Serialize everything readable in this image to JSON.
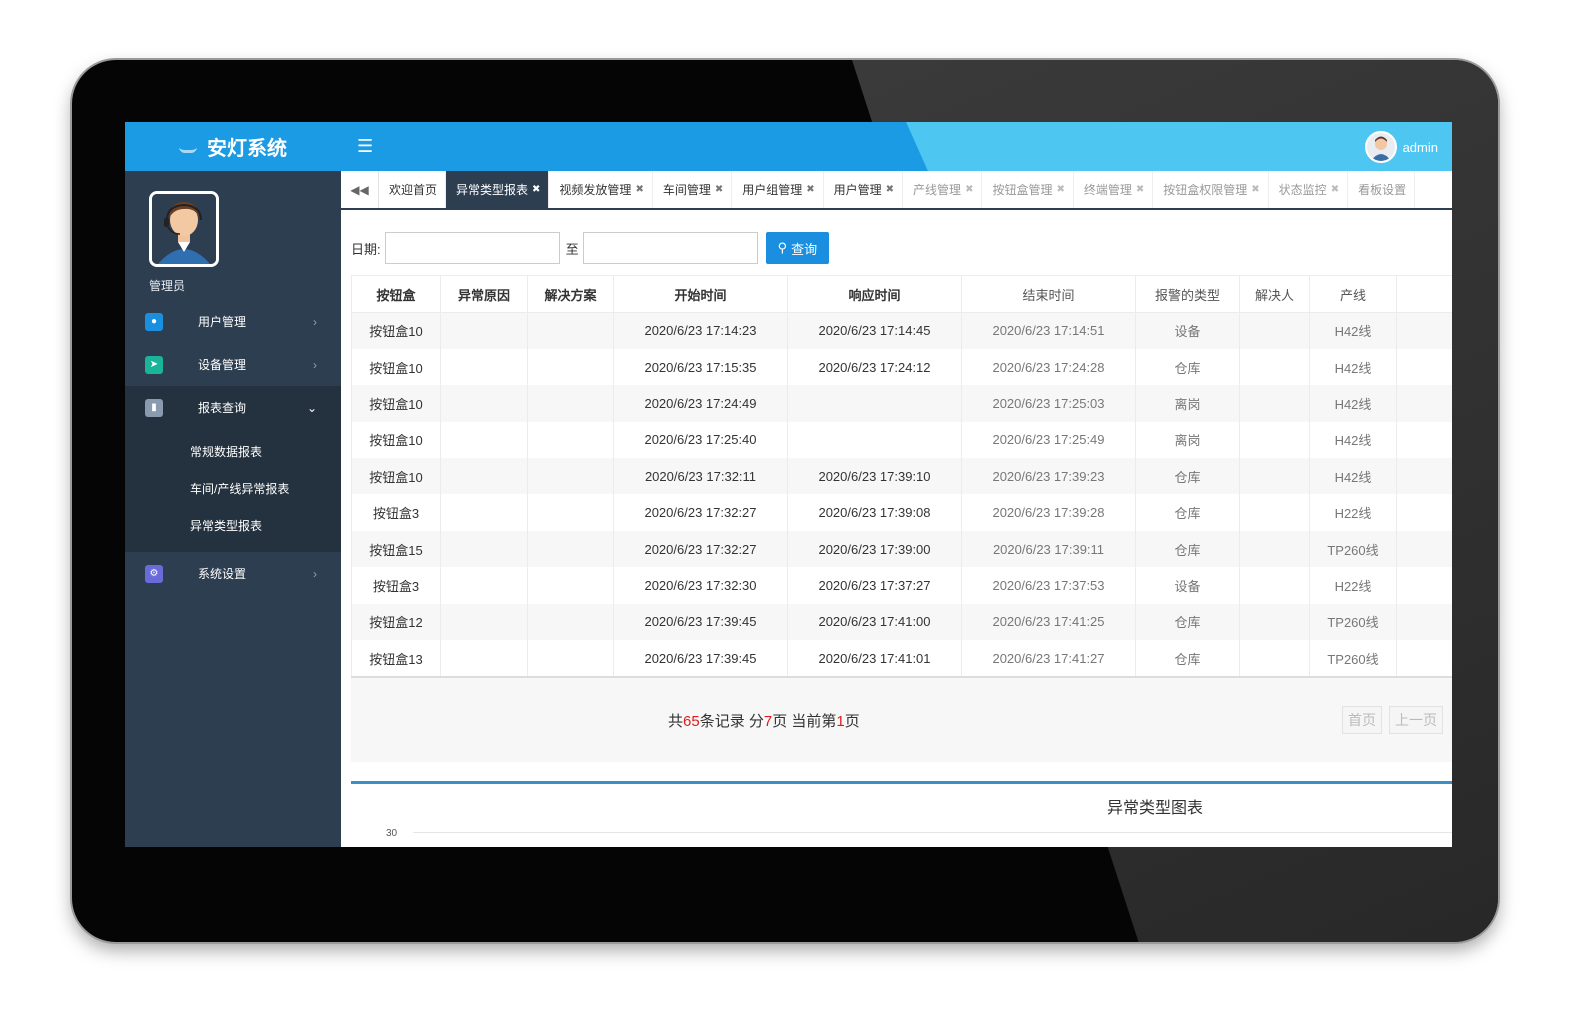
{
  "app": {
    "title": "安灯系统",
    "user": "admin"
  },
  "sidebar": {
    "profile_name": "管理员",
    "items": [
      {
        "label": "用户管理",
        "icon": "user-icon",
        "color": "#1a8fe0"
      },
      {
        "label": "设备管理",
        "icon": "wrench-icon",
        "color": "#19b49a"
      },
      {
        "label": "报表查询",
        "icon": "chart-icon",
        "color": "#8a9bb0"
      },
      {
        "label": "系统设置",
        "icon": "gear-icon",
        "color": "#6a6ad8"
      }
    ],
    "subitems": [
      "常规数据报表",
      "车间/产线异常报表",
      "异常类型报表"
    ]
  },
  "tabs": [
    {
      "label": "欢迎首页",
      "closable": false
    },
    {
      "label": "异常类型报表",
      "closable": true,
      "active": true
    },
    {
      "label": "视频发放管理",
      "closable": true
    },
    {
      "label": "车间管理",
      "closable": true
    },
    {
      "label": "用户组管理",
      "closable": true
    },
    {
      "label": "用户管理",
      "closable": true
    },
    {
      "label": "产线管理",
      "closable": true
    },
    {
      "label": "按钮盒管理",
      "closable": true
    },
    {
      "label": "终端管理",
      "closable": true
    },
    {
      "label": "按钮盒权限管理",
      "closable": true
    },
    {
      "label": "状态监控",
      "closable": true
    },
    {
      "label": "看板设置",
      "closable": false
    }
  ],
  "filter": {
    "date_label": "日期:",
    "to_label": "至",
    "query_label": "查询"
  },
  "table": {
    "columns": [
      "按钮盒",
      "异常原因",
      "解决方案",
      "开始时间",
      "响应时间",
      "结束时间",
      "报警的类型",
      "解决人",
      "产线"
    ],
    "rows": [
      [
        "按钮盒10",
        "",
        "",
        "2020/6/23 17:14:23",
        "2020/6/23 17:14:45",
        "2020/6/23 17:14:51",
        "设备",
        "",
        "H42线"
      ],
      [
        "按钮盒10",
        "",
        "",
        "2020/6/23 17:15:35",
        "2020/6/23 17:24:12",
        "2020/6/23 17:24:28",
        "仓库",
        "",
        "H42线"
      ],
      [
        "按钮盒10",
        "",
        "",
        "2020/6/23 17:24:49",
        "",
        "2020/6/23 17:25:03",
        "离岗",
        "",
        "H42线"
      ],
      [
        "按钮盒10",
        "",
        "",
        "2020/6/23 17:25:40",
        "",
        "2020/6/23 17:25:49",
        "离岗",
        "",
        "H42线"
      ],
      [
        "按钮盒10",
        "",
        "",
        "2020/6/23 17:32:11",
        "2020/6/23 17:39:10",
        "2020/6/23 17:39:23",
        "仓库",
        "",
        "H42线"
      ],
      [
        "按钮盒3",
        "",
        "",
        "2020/6/23 17:32:27",
        "2020/6/23 17:39:08",
        "2020/6/23 17:39:28",
        "仓库",
        "",
        "H22线"
      ],
      [
        "按钮盒15",
        "",
        "",
        "2020/6/23 17:32:27",
        "2020/6/23 17:39:00",
        "2020/6/23 17:39:11",
        "仓库",
        "",
        "TP260线"
      ],
      [
        "按钮盒3",
        "",
        "",
        "2020/6/23 17:32:30",
        "2020/6/23 17:37:27",
        "2020/6/23 17:37:53",
        "设备",
        "",
        "H22线"
      ],
      [
        "按钮盒12",
        "",
        "",
        "2020/6/23 17:39:45",
        "2020/6/23 17:41:00",
        "2020/6/23 17:41:25",
        "仓库",
        "",
        "TP260线"
      ],
      [
        "按钮盒13",
        "",
        "",
        "2020/6/23 17:39:45",
        "2020/6/23 17:41:01",
        "2020/6/23 17:41:27",
        "仓库",
        "",
        "TP260线"
      ]
    ]
  },
  "pager": {
    "prefix": "共",
    "total": "65",
    "mid1": "条记录 分",
    "pages": "7",
    "mid2": "页 当前第",
    "current": "1",
    "suffix": "页",
    "first_label": "首页",
    "prev_label": "上一页"
  },
  "chart": {
    "title": "异常类型图表",
    "tick": "30"
  },
  "colors": {
    "topbar_blue": "#1a9be3",
    "topbar_light": "#4dc6f2",
    "sidebar": "#2d3e50",
    "accent": "#1a8fe0",
    "highlight": "#e21a1a"
  }
}
